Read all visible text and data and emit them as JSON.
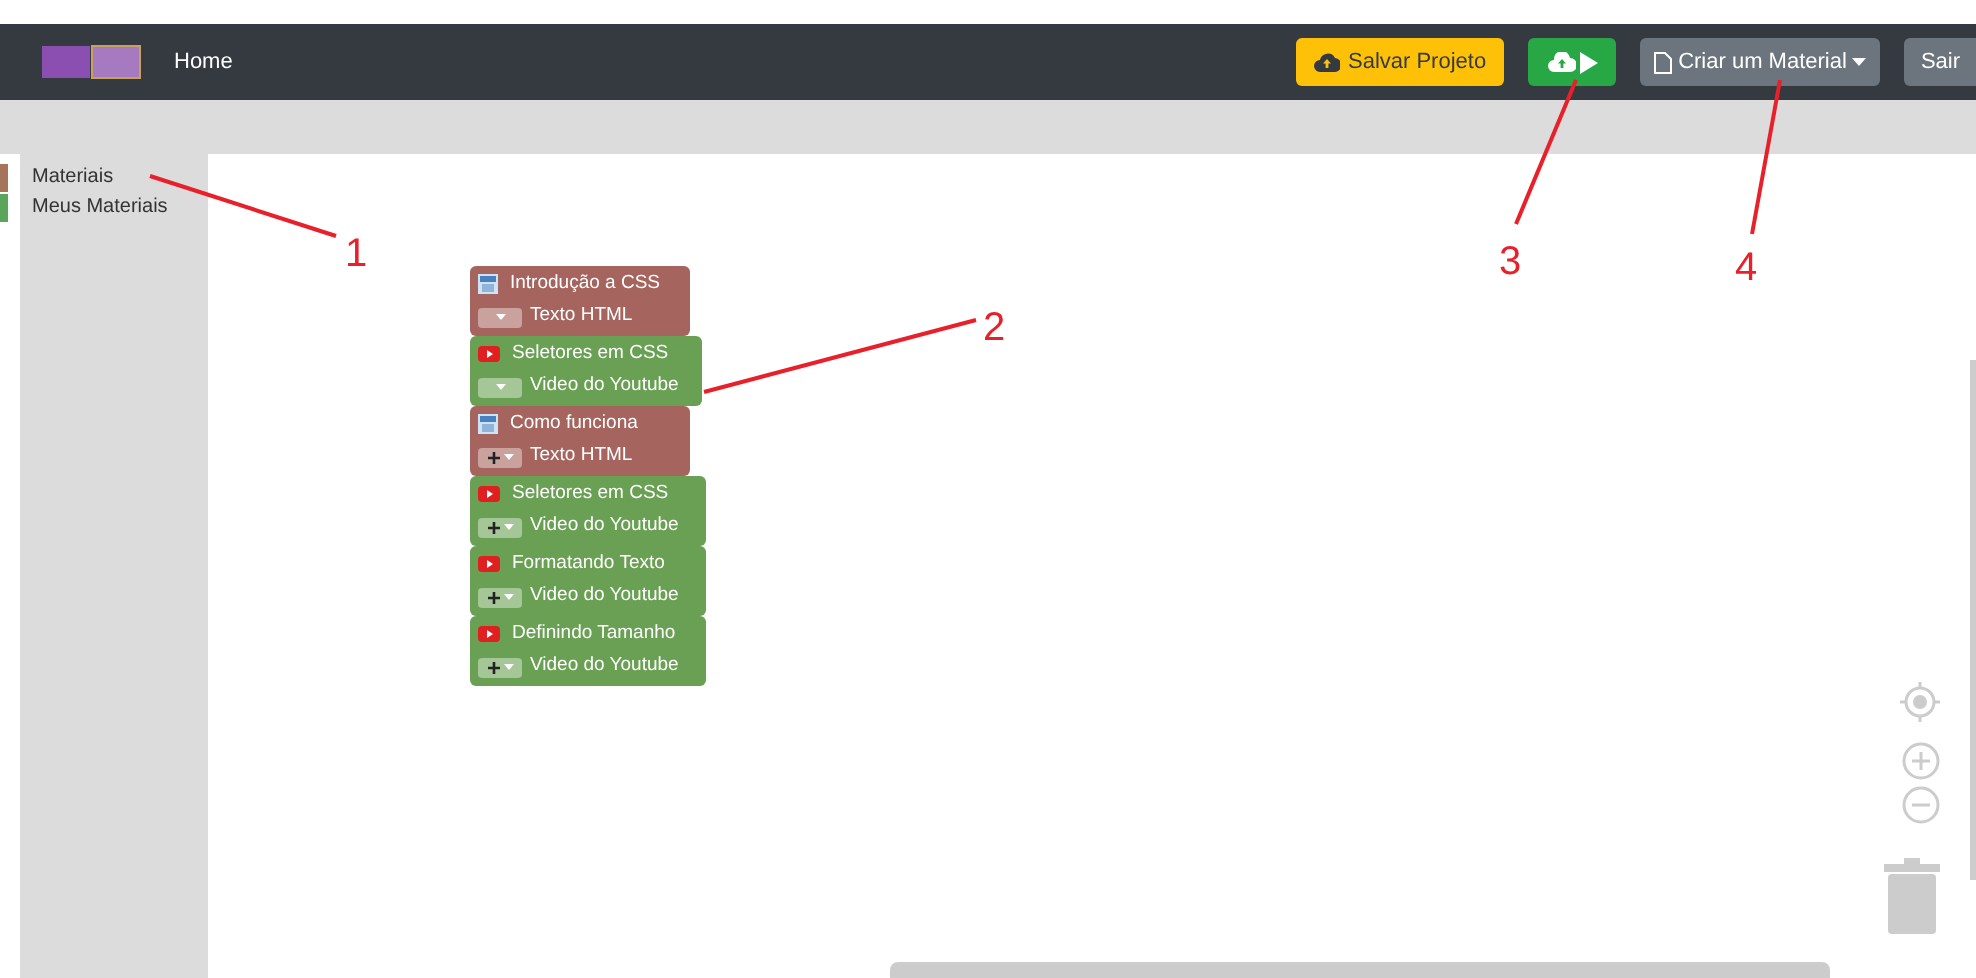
{
  "navbar": {
    "brand": "Home",
    "buttons": [
      {
        "kind": "save",
        "label": "Salvar Projeto"
      },
      {
        "kind": "publish"
      },
      {
        "kind": "dropdown",
        "label": "Criar um Material"
      },
      {
        "kind": "plain",
        "label": "Sair"
      }
    ]
  },
  "toolbox": [
    {
      "label": "Materiais",
      "color": "#a5745a"
    },
    {
      "label": "Meus Materiais",
      "color": "#5ba55b"
    }
  ],
  "blocks": [
    {
      "kind": "html",
      "title": "Introdução a CSS",
      "type_label": "Texto HTML",
      "plus": false
    },
    {
      "kind": "youtube",
      "title": "Seletores em CSS",
      "type_label": "Video do Youtube",
      "plus": false
    },
    {
      "kind": "html",
      "title": "Como funciona",
      "type_label": "Texto HTML",
      "plus": true
    },
    {
      "kind": "youtube",
      "title": "Seletores em CSS",
      "type_label": "Video do Youtube",
      "plus": true
    },
    {
      "kind": "youtube",
      "title": "Formatando Texto",
      "type_label": "Video do Youtube",
      "plus": true
    },
    {
      "kind": "youtube",
      "title": "Definindo Tamanho",
      "type_label": "Video do Youtube",
      "plus": true
    }
  ],
  "annotations": [
    "1",
    "2",
    "3",
    "4"
  ]
}
